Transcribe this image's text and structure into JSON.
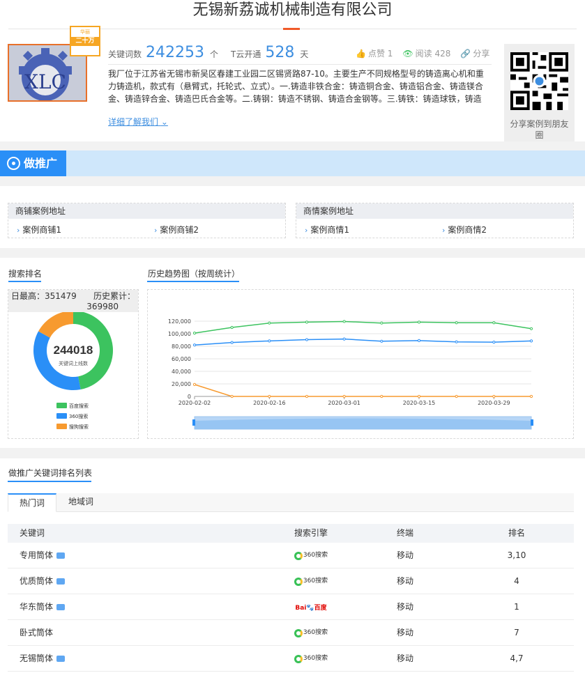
{
  "header": {
    "company_name": "无锡新荔诚机械制造有限公司",
    "badge_top": "华丽",
    "badge_text": "二十万",
    "logo_text": "XLC",
    "keyword_label": "关键词数",
    "keyword_value": "242253",
    "keyword_unit": "个",
    "tcloud_label": "T云开通",
    "tcloud_value": "528",
    "tcloud_unit": "天",
    "like_label": "点赞 1",
    "read_label": "阅读 428",
    "share_label": "分享",
    "description": "我厂位于江苏省无锡市新吴区春建工业园二区锡贤路87-10。主要生产不同规格型号的铸造离心机和重力铸造机，款式有（悬臂式，托轮式、立式）。一.铸造非铁合金：铸造铜合金、铸造铝合金、铸造镁合金、铸造锌合金、铸造巴氏合金等。二.铸钢：铸造不锈钢、铸造合金钢等。三.铸铁：铸造球铁，铸造",
    "more_link": "详细了解我们",
    "qr_caption": "分享案例到朋友圈"
  },
  "promo": {
    "label": "做推广"
  },
  "addresses": {
    "shop_title": "商铺案例地址",
    "shop_links": [
      "案例商铺1",
      "案例商铺2"
    ],
    "info_title": "商情案例地址",
    "info_links": [
      "案例商情1",
      "案例商情2"
    ]
  },
  "ranking": {
    "title": "搜索排名",
    "daily_max": "日最高：351479",
    "total": "历史累计：369980",
    "donut_value": "244018",
    "donut_caption": "关键词上线数",
    "legend": [
      "百度搜索",
      "360搜索",
      "搜狗搜索"
    ]
  },
  "trend": {
    "title": "历史趋势图（按周统计）"
  },
  "chart_data": [
    {
      "type": "pie",
      "categories": [
        "百度搜索",
        "360搜索",
        "搜狗搜索"
      ],
      "values": [
        47,
        36,
        17
      ],
      "colors": [
        "#3cc35f",
        "#2a8ff7",
        "#f79a2f"
      ]
    },
    {
      "type": "line",
      "x": [
        "2020-02-02",
        "2020-02-09",
        "2020-02-16",
        "2020-02-23",
        "2020-03-01",
        "2020-03-08",
        "2020-03-15",
        "2020-03-22",
        "2020-03-29",
        "2020-04-05"
      ],
      "x_tick_labels": [
        "2020-02-02",
        "2020-02-16",
        "2020-03-01",
        "2020-03-15",
        "2020-03-29"
      ],
      "y_ticks": [
        0,
        20000,
        40000,
        60000,
        80000,
        100000,
        120000
      ],
      "y_tick_labels": [
        "0",
        "20,000",
        "40,000",
        "60,000",
        "80,000",
        "100,000",
        "120,000"
      ],
      "ylim": [
        0,
        120000
      ],
      "series": [
        {
          "values": [
            101000,
            110000,
            117000,
            118500,
            119500,
            117000,
            118500,
            117500,
            117500,
            108000
          ],
          "color": "#3cc35f"
        },
        {
          "values": [
            82000,
            86000,
            88500,
            90500,
            91500,
            88000,
            89000,
            87000,
            86500,
            88500
          ],
          "color": "#2a8ff7"
        },
        {
          "values": [
            19000,
            0,
            0,
            0,
            0,
            0,
            0,
            0,
            0,
            0
          ],
          "color": "#f79a2f"
        }
      ],
      "grid": true
    }
  ],
  "keywords": {
    "title": "做推广关键词排名列表",
    "tabs": [
      "热门词",
      "地域词"
    ],
    "columns": [
      "关键词",
      "搜索引擎",
      "终端",
      "排名"
    ],
    "rows": [
      {
        "keyword": "专用筒体",
        "engine": "360",
        "terminal": "移动",
        "rank": "3,10",
        "tag": true
      },
      {
        "keyword": "优质筒体",
        "engine": "360",
        "terminal": "移动",
        "rank": "4",
        "tag": true
      },
      {
        "keyword": "华东筒体",
        "engine": "baidu",
        "terminal": "移动",
        "rank": "1",
        "tag": true
      },
      {
        "keyword": "卧式筒体",
        "engine": "360",
        "terminal": "移动",
        "rank": "7",
        "tag": false
      },
      {
        "keyword": "无锡筒体",
        "engine": "360",
        "terminal": "移动",
        "rank": "4,7",
        "tag": true
      }
    ],
    "engine_labels": {
      "360": "360搜索",
      "baidu_a": "Bai",
      "baidu_b": "百度"
    }
  },
  "colors": {
    "accent": "#2a8ff7",
    "value_blue": "#3d8ee0",
    "orange": "#f05a28"
  }
}
